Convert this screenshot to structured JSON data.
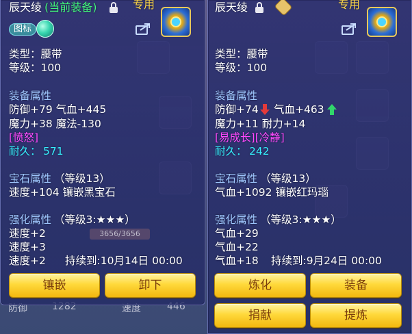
{
  "left": {
    "name": "辰天绫",
    "current_tag": "(当前装备)",
    "exclusive": "专用",
    "icon_badge": "图标",
    "type": "类型：腰带",
    "level": "等级：100",
    "equip_attr_title": "装备属性",
    "attr_line1": "防御+79 气血+445",
    "attr_line2": "魔力+38 魔法-130",
    "special": "[愤怒]",
    "durability_label": "耐久：",
    "durability_value": "571",
    "gem_title": "宝石属性",
    "gem_level": "（等级13）",
    "gem_line": "速度+104 镶嵌黑宝石",
    "enhance_title": "强化属性",
    "enhance_level": "（等级3:★★★）",
    "enhance_lines": [
      "速度+2",
      "速度+3",
      "速度+2"
    ],
    "duration": "持续到:10月14日 00:00",
    "buttons": [
      "镶嵌",
      "卸下"
    ]
  },
  "right": {
    "name": "辰天绫",
    "exclusive": "专用",
    "type": "类型：腰带",
    "level": "等级：100",
    "equip_attr_title": "装备属性",
    "attr_line1_a": "防御+74",
    "attr_line1_b": "气血+463",
    "attr_line2": "魔力+11 耐力+14",
    "special": "[易成长][冷静]",
    "durability_label": "耐久：",
    "durability_value": "242",
    "gem_title": "宝石属性",
    "gem_level": "（等级13）",
    "gem_line": "气血+1092 镶嵌红玛瑙",
    "enhance_title": "强化属性",
    "enhance_level": "（等级3:★★★）",
    "enhance_lines": [
      "气血+29",
      "气血+22",
      "气血+18"
    ],
    "duration": "持续到:9月24日 00:00",
    "buttons": [
      "炼化",
      "装备",
      "捐献",
      "提炼"
    ]
  },
  "background": {
    "bottom_left": "防御",
    "bottom_left_value": "1282",
    "bottom_mid": "速度",
    "bottom_mid_value": "446",
    "hp_bar": "3656/3656"
  },
  "colors": {
    "panel": "#2a2f72",
    "green": "#41f77c",
    "section": "#9fc7ff",
    "magenta": "#ff49ff",
    "cyan": "#36f0ff",
    "button": "#ffd93b",
    "button_text": "#7a3d0c",
    "down_arrow": "#e33a3a",
    "up_arrow": "#31d66b"
  }
}
